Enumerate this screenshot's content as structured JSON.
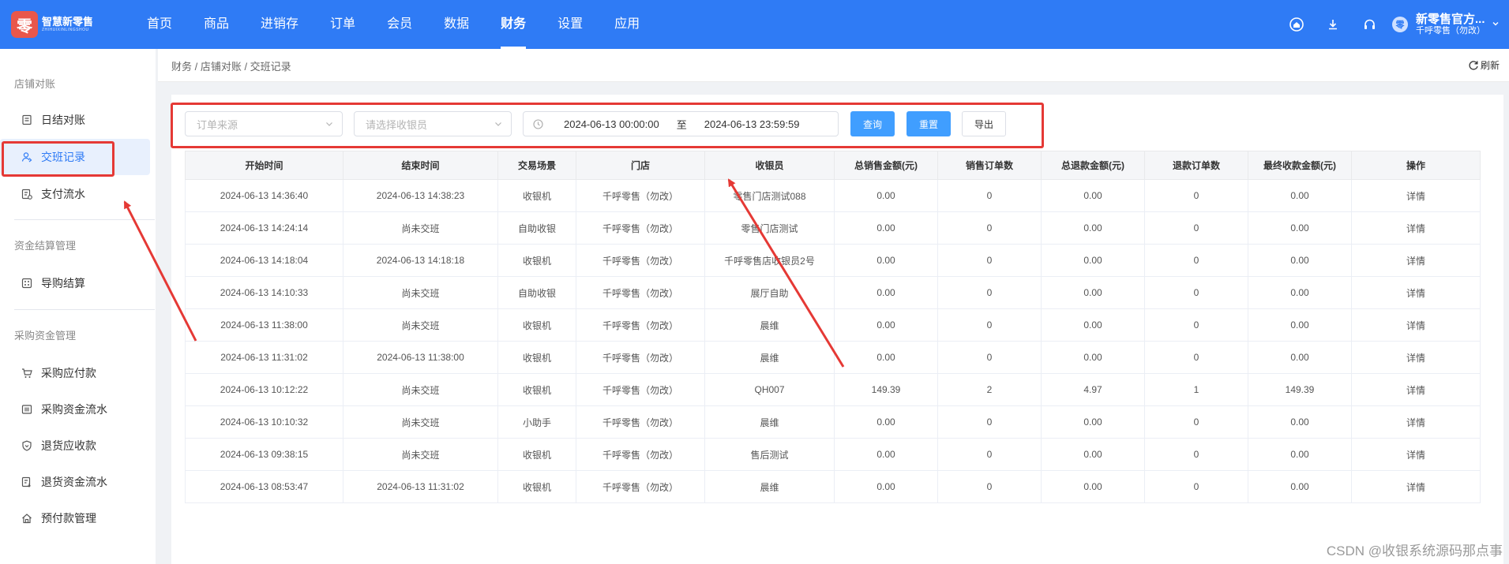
{
  "logo": {
    "mark": "零",
    "name": "智慧新零售",
    "pinyin": "ZHIHUIXINLINGSHOU"
  },
  "nav": [
    "首页",
    "商品",
    "进销存",
    "订单",
    "会员",
    "数据",
    "财务",
    "设置",
    "应用"
  ],
  "nav_active": "财务",
  "top_icons": [
    "home-icon",
    "download-icon",
    "headset-icon"
  ],
  "user": {
    "avatar": "零",
    "name": "新零售官方...",
    "store": "千呼零售（勿改）"
  },
  "sidebar": {
    "groups": [
      "店铺对账",
      "资金结算管理",
      "采购资金管理"
    ],
    "items": [
      {
        "label": "日结对账",
        "icon": "document-icon"
      },
      {
        "label": "交班记录",
        "icon": "user-switch-icon",
        "active": true
      },
      {
        "label": "支付流水",
        "icon": "payment-flow-icon"
      },
      {
        "label": "导购结算",
        "icon": "grid-icon"
      },
      {
        "label": "采购应付款",
        "icon": "cart-icon"
      },
      {
        "label": "采购资金流水",
        "icon": "ledger-icon"
      },
      {
        "label": "退货应收款",
        "icon": "shield-icon"
      },
      {
        "label": "退货资金流水",
        "icon": "return-doc-icon"
      },
      {
        "label": "预付款管理",
        "icon": "house-icon"
      }
    ]
  },
  "breadcrumb": "财务 / 店铺对账 / 交班记录",
  "refresh_label": "刷新",
  "filters": {
    "order_source_placeholder": "订单来源",
    "cashier_placeholder": "请选择收银员",
    "date_start": "2024-06-13 00:00:00",
    "date_sep": "至",
    "date_end": "2024-06-13 23:59:59",
    "query_label": "查询",
    "reset_label": "重置",
    "export_label": "导出"
  },
  "table": {
    "headers": [
      "开始时间",
      "结束时间",
      "交易场景",
      "门店",
      "收银员",
      "总销售金额(元)",
      "销售订单数",
      "总退款金额(元)",
      "退款订单数",
      "最终收款金额(元)",
      "操作"
    ],
    "rows": [
      [
        "2024-06-13 14:36:40",
        "2024-06-13 14:38:23",
        "收银机",
        "千呼零售（勿改）",
        "零售门店测试088",
        "0.00",
        "0",
        "0.00",
        "0",
        "0.00",
        "详情"
      ],
      [
        "2024-06-13 14:24:14",
        "尚未交班",
        "自助收银",
        "千呼零售（勿改）",
        "零售门店测试",
        "0.00",
        "0",
        "0.00",
        "0",
        "0.00",
        "详情"
      ],
      [
        "2024-06-13 14:18:04",
        "2024-06-13 14:18:18",
        "收银机",
        "千呼零售（勿改）",
        "千呼零售店收银员2号",
        "0.00",
        "0",
        "0.00",
        "0",
        "0.00",
        "详情"
      ],
      [
        "2024-06-13 14:10:33",
        "尚未交班",
        "自助收银",
        "千呼零售（勿改）",
        "展厅自助",
        "0.00",
        "0",
        "0.00",
        "0",
        "0.00",
        "详情"
      ],
      [
        "2024-06-13 11:38:00",
        "尚未交班",
        "收银机",
        "千呼零售（勿改）",
        "晨维",
        "0.00",
        "0",
        "0.00",
        "0",
        "0.00",
        "详情"
      ],
      [
        "2024-06-13 11:31:02",
        "2024-06-13 11:38:00",
        "收银机",
        "千呼零售（勿改）",
        "晨维",
        "0.00",
        "0",
        "0.00",
        "0",
        "0.00",
        "详情"
      ],
      [
        "2024-06-13 10:12:22",
        "尚未交班",
        "收银机",
        "千呼零售（勿改）",
        "QH007",
        "149.39",
        "2",
        "4.97",
        "1",
        "149.39",
        "详情"
      ],
      [
        "2024-06-13 10:10:32",
        "尚未交班",
        "小助手",
        "千呼零售（勿改）",
        "晨维",
        "0.00",
        "0",
        "0.00",
        "0",
        "0.00",
        "详情"
      ],
      [
        "2024-06-13 09:38:15",
        "尚未交班",
        "收银机",
        "千呼零售（勿改）",
        "售后测试",
        "0.00",
        "0",
        "0.00",
        "0",
        "0.00",
        "详情"
      ],
      [
        "2024-06-13 08:53:47",
        "2024-06-13 11:31:02",
        "收银机",
        "千呼零售（勿改）",
        "晨维",
        "0.00",
        "0",
        "0.00",
        "0",
        "0.00",
        "详情"
      ]
    ],
    "pending_text": "尚未交班"
  },
  "colors": {
    "topbar": "#2f7bf5",
    "accent": "#409eff",
    "pending": "#e02424",
    "annotation": "#e53935"
  },
  "watermark": "CSDN @收银系统源码那点事"
}
